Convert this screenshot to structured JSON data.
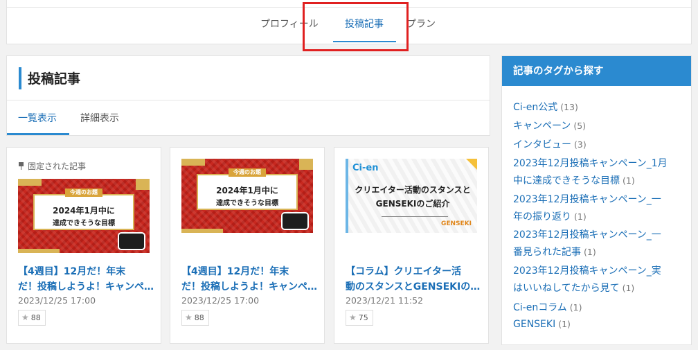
{
  "tabs": [
    {
      "label": "プロフィール",
      "active": false
    },
    {
      "label": "投稿記事",
      "active": true
    },
    {
      "label": "プラン",
      "active": false
    }
  ],
  "section": {
    "title": "投稿記事",
    "subtabs": [
      {
        "label": "一覧表示",
        "active": true
      },
      {
        "label": "詳細表示",
        "active": false
      }
    ]
  },
  "articles": [
    {
      "pinned_label": "固定された記事",
      "thumb_ribbon": "今週のお題",
      "thumb_line1": "2024年1月中に",
      "thumb_line2": "達成できそうな目標",
      "title_line1": "【4週目】12月だ！年末",
      "title_line2": "だ！投稿しようよ！キャンペーン",
      "date": "2023/12/25 17:00",
      "likes": "88"
    },
    {
      "thumb_ribbon": "今週のお題",
      "thumb_line1": "2024年1月中に",
      "thumb_line2": "達成できそうな目標",
      "title_line1": "【4週目】12月だ！年末",
      "title_line2": "だ！投稿しようよ！キャンペーン",
      "date": "2023/12/25 17:00",
      "likes": "88"
    },
    {
      "thumb_logo": "Ci-en",
      "thumb_line1": "クリエイター活動のスタンスと",
      "thumb_line2": "GENSEKIのご紹介",
      "thumb_brand": "GENSEKI",
      "title_line1": "【コラム】クリエイター活",
      "title_line2": "動のスタンスとGENSEKIのご紹介",
      "date": "2023/12/21 11:52",
      "likes": "75"
    }
  ],
  "sidebar": {
    "title": "記事のタグから探す",
    "tags": [
      {
        "lines": [
          "Ci-en公式"
        ],
        "count": "(13)"
      },
      {
        "lines": [
          "キャンペーン"
        ],
        "count": "(5)"
      },
      {
        "lines": [
          "インタビュー"
        ],
        "count": "(3)"
      },
      {
        "lines": [
          "2023年12月投稿キャンペーン_1月",
          "中に達成できそうな目標"
        ],
        "count": "(1)"
      },
      {
        "lines": [
          "2023年12月投稿キャンペーン_一",
          "年の振り返り"
        ],
        "count": "(1)"
      },
      {
        "lines": [
          "2023年12月投稿キャンペーン_一",
          "番見られた記事"
        ],
        "count": "(1)"
      },
      {
        "lines": [
          "2023年12月投稿キャンペーン_実",
          "はいいねしてたから見て"
        ],
        "count": "(1)"
      },
      {
        "lines": [
          "Ci-enコラム"
        ],
        "count": "(1)"
      },
      {
        "lines": [
          "GENSEKI"
        ],
        "count": "(1)"
      }
    ]
  },
  "colors": {
    "accent": "#2b8ad0",
    "link": "#1a6eb6",
    "highlight": "#e02020"
  }
}
